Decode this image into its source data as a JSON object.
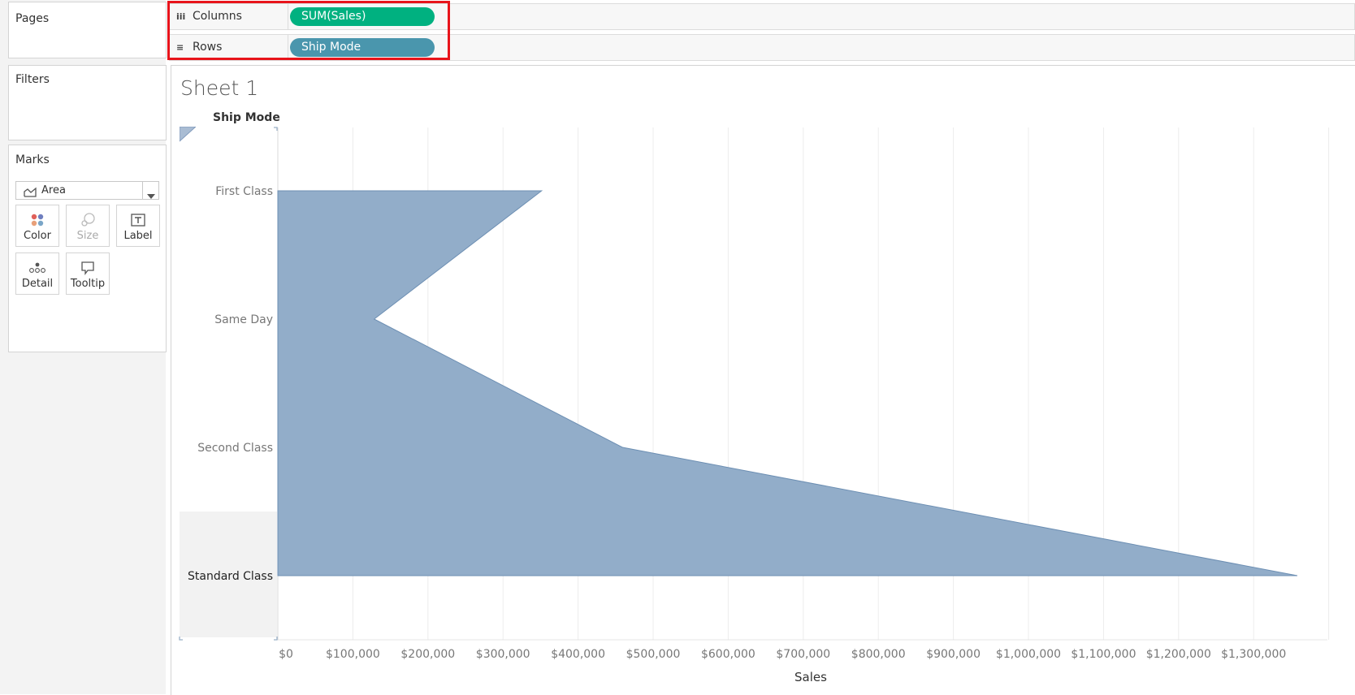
{
  "sidebar": {
    "pages_title": "Pages",
    "filters_title": "Filters",
    "marks_title": "Marks",
    "mark_type": "Area",
    "mark_buttons": {
      "color": "Color",
      "size": "Size",
      "label": "Label",
      "detail": "Detail",
      "tooltip": "Tooltip"
    }
  },
  "shelves": {
    "columns_label": "Columns",
    "columns_pill": "SUM(Sales)",
    "rows_label": "Rows",
    "rows_pill": "Ship Mode"
  },
  "colors": {
    "columns_pill": "#00b180",
    "rows_pill": "#4a96ad",
    "area_fill": "#92adc9",
    "area_stroke": "#6d8fb3",
    "highlight": "#e8141b"
  },
  "sheet": {
    "title": "Sheet 1",
    "row_header": "Ship Mode"
  },
  "chart_data": {
    "type": "area",
    "orientation": "horizontal",
    "categories": [
      "First Class",
      "Same Day",
      "Second Class",
      "Standard Class"
    ],
    "series": [
      {
        "values": [
          351428,
          128363,
          459194,
          1358216
        ]
      }
    ],
    "xlabel": "Sales",
    "xlim": [
      0,
      1400000
    ],
    "x_ticks": [
      "$0",
      "$100,000",
      "$200,000",
      "$300,000",
      "$400,000",
      "$500,000",
      "$600,000",
      "$700,000",
      "$800,000",
      "$900,000",
      "$1,000,000",
      "$1,100,000",
      "$1,200,000",
      "$1,300,000"
    ],
    "grid": true,
    "selected_category": "Standard Class"
  }
}
